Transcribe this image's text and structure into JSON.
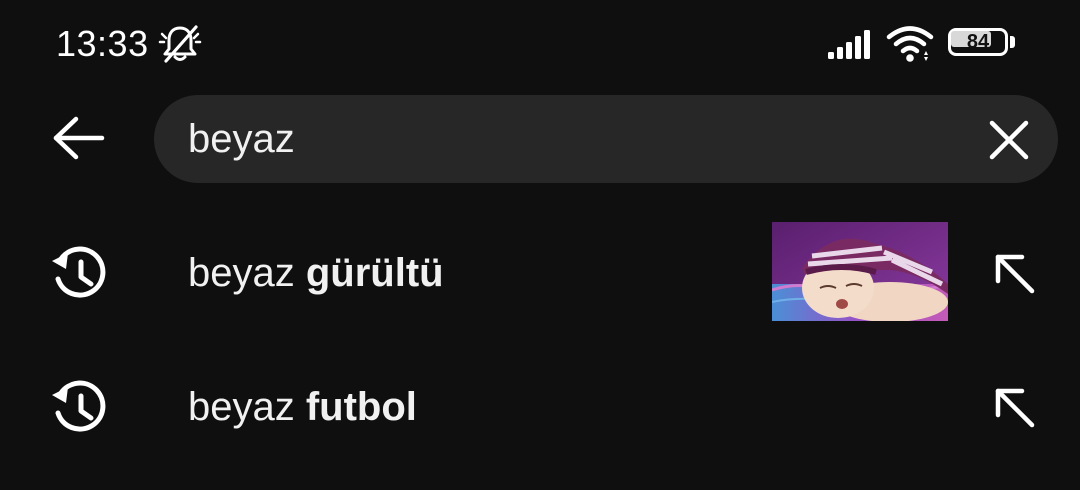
{
  "status_bar": {
    "time": "13:33",
    "battery_level": "84",
    "battery_fraction": 0.84,
    "icons": [
      "bell-off-icon",
      "cellular-signal-icon",
      "wifi-icon",
      "battery-icon"
    ]
  },
  "search": {
    "query": "beyaz",
    "back_icon": "arrow-left-icon",
    "clear_icon": "close-icon"
  },
  "suggestions": [
    {
      "prefix": "beyaz ",
      "completion": "gürültü",
      "icon": "history-icon",
      "has_thumbnail": true,
      "thumbnail": "sleeping-baby-in-striped-purple-hat",
      "action_icon": "arrow-up-left-icon"
    },
    {
      "prefix": "beyaz ",
      "completion": "futbol",
      "icon": "history-icon",
      "has_thumbnail": false,
      "action_icon": "arrow-up-left-icon"
    }
  ],
  "colors": {
    "background": "#0f0f0f",
    "search_field": "#272727",
    "text": "#f1f1f1",
    "icon": "#ffffff"
  }
}
